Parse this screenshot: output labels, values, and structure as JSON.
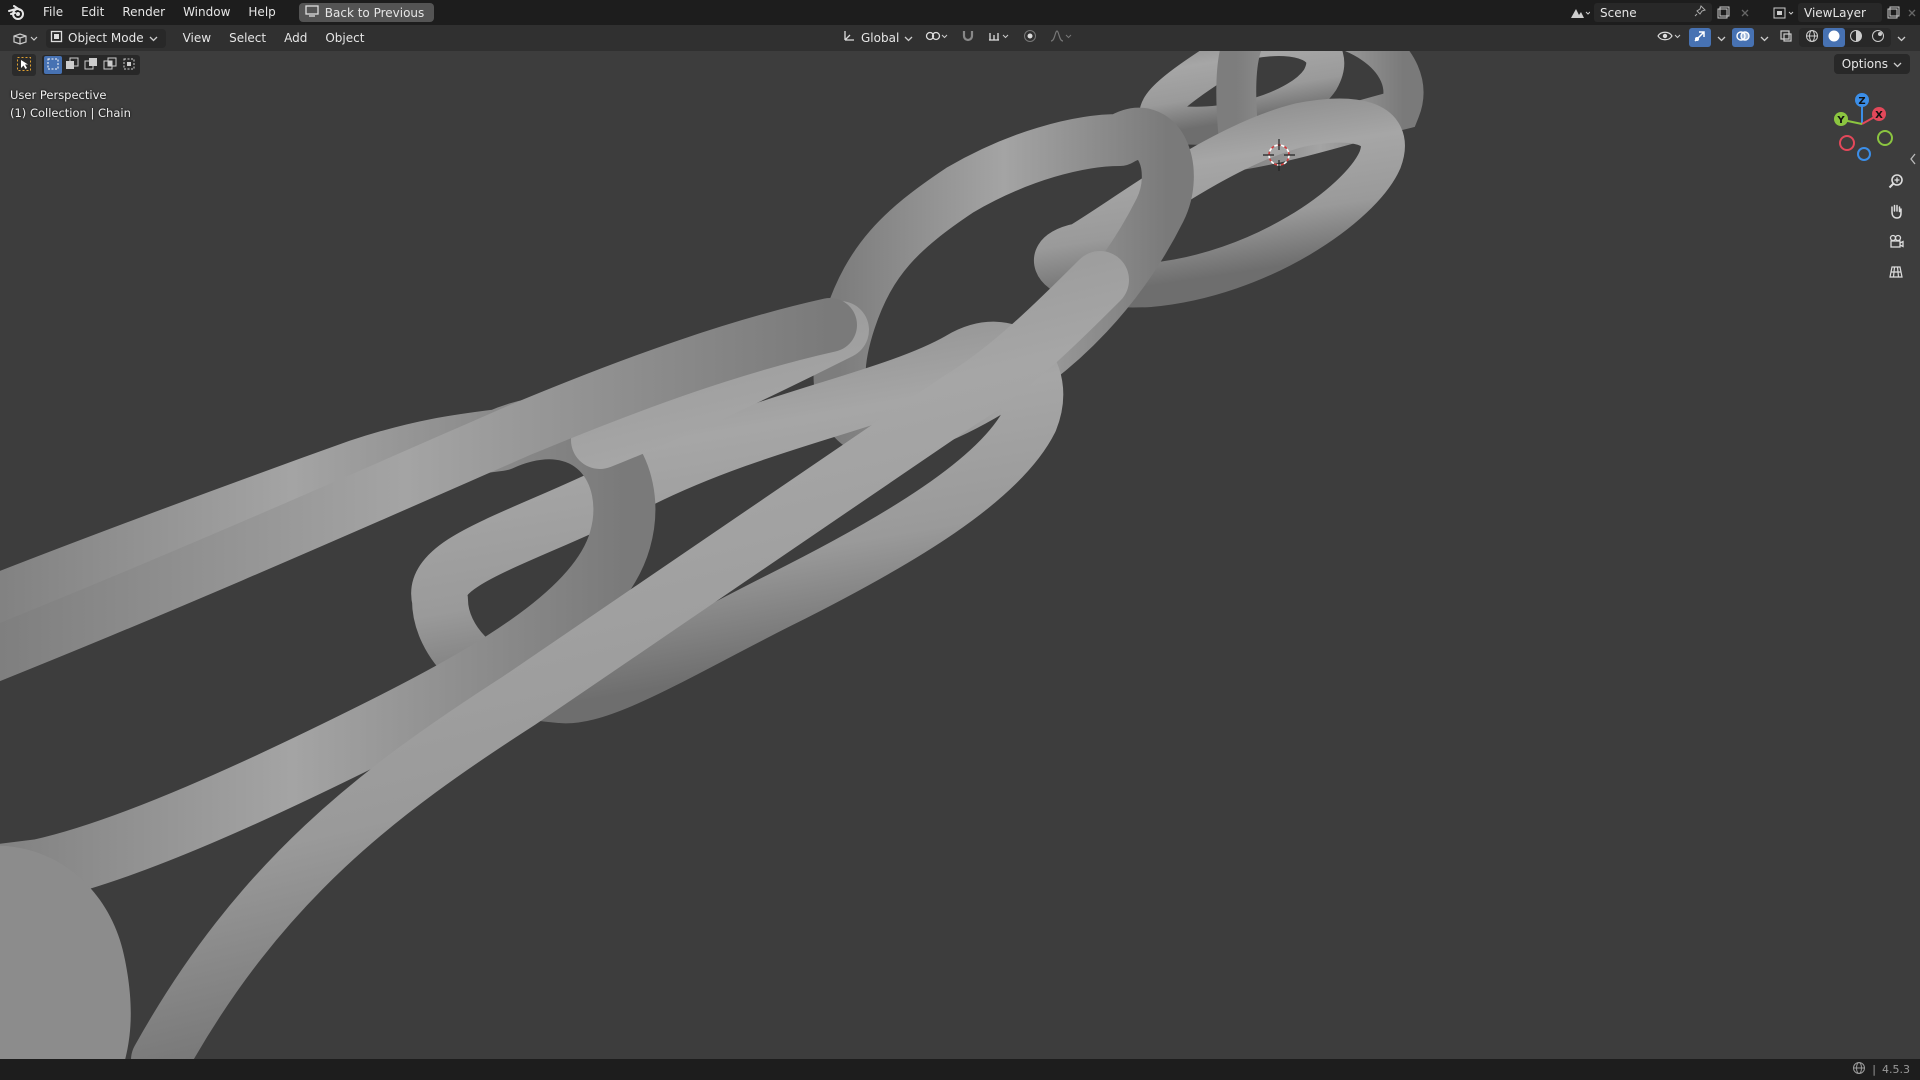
{
  "topbar": {
    "menus": [
      "File",
      "Edit",
      "Render",
      "Window",
      "Help"
    ],
    "back_label": "Back to Previous",
    "scene_name": "Scene",
    "view_layer": "ViewLayer"
  },
  "header": {
    "mode_label": "Object Mode",
    "menus": [
      "View",
      "Select",
      "Add",
      "Object"
    ],
    "transform_orientation": "Global"
  },
  "toolbar": {
    "options_label": "Options"
  },
  "viewport": {
    "perspective_label": "User Perspective",
    "collection_label": "(1) Collection | Chain"
  },
  "gizmo": {
    "x_label": "X",
    "y_label": "Y",
    "z_label": "Z",
    "x_color": "#e3485a",
    "y_color": "#8bc540",
    "z_color": "#3b8ee8"
  },
  "statusbar": {
    "version": "4.5.3"
  },
  "colors": {
    "topbar_bg": "#1d1d1d",
    "header_bg": "#303030",
    "viewport_bg": "#3d3d3d",
    "accent": "#4772b3",
    "chain_color": "#9a9a9a"
  }
}
